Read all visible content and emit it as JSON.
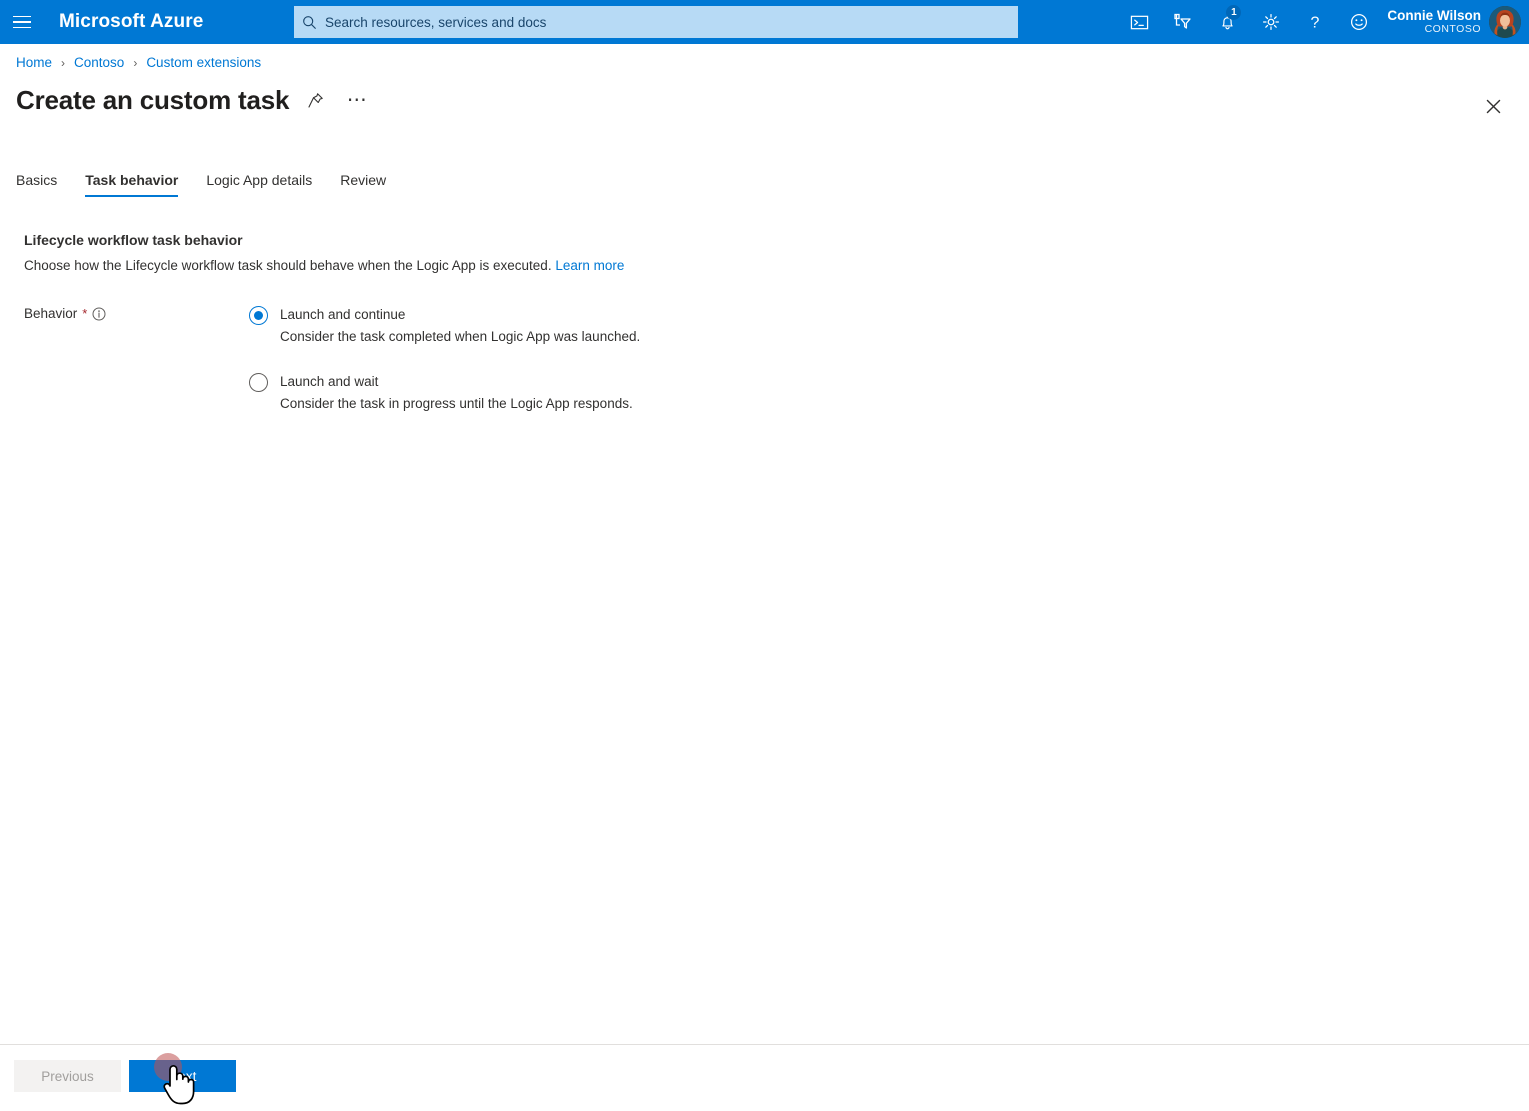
{
  "header": {
    "menu_icon": "hamburger-menu-icon",
    "brand": "Microsoft Azure",
    "search": {
      "placeholder": "Search resources, services and docs",
      "value": "",
      "icon": "search-icon"
    },
    "icons": [
      {
        "name": "cloud-shell-icon",
        "label": "Cloud Shell"
      },
      {
        "name": "directory-filter-icon",
        "label": "Directories + subscriptions"
      },
      {
        "name": "notifications-bell-icon",
        "label": "Notifications",
        "badge": "1"
      },
      {
        "name": "settings-gear-icon",
        "label": "Settings"
      },
      {
        "name": "help-question-icon",
        "label": "Help"
      },
      {
        "name": "feedback-smiley-icon",
        "label": "Feedback"
      }
    ],
    "account": {
      "name": "Connie Wilson",
      "org": "CONTOSO",
      "avatar": "user-avatar"
    },
    "accent_color": "#0078d4",
    "search_bg": "#b7daf5"
  },
  "breadcrumb": {
    "items": [
      "Home",
      "Contoso",
      "Custom extensions"
    ],
    "separator": "›"
  },
  "page": {
    "title": "Create an custom task",
    "pin_icon": "pin-icon",
    "more_icon": "more-ellipsis-icon",
    "close_icon": "close-icon"
  },
  "tabs": [
    {
      "label": "Basics",
      "active": false
    },
    {
      "label": "Task behavior",
      "active": true
    },
    {
      "label": "Logic App details",
      "active": false
    },
    {
      "label": "Review",
      "active": false
    }
  ],
  "main": {
    "section_title": "Lifecycle workflow task behavior",
    "section_desc": "Choose how the Lifecycle workflow task should behave when the Logic App is executed.",
    "learn_more": "Learn more",
    "field_label": "Behavior",
    "required_marker": "*",
    "info_icon": "info-icon",
    "options": [
      {
        "label": "Launch and continue",
        "description": "Consider the task completed when Logic App was launched.",
        "checked": true
      },
      {
        "label": "Launch and wait",
        "description": "Consider the task in progress until the Logic App responds.",
        "checked": false
      }
    ]
  },
  "footer": {
    "previous_label": "Previous",
    "previous_enabled": false,
    "next_label": "Next",
    "primary_color": "#0078d4"
  }
}
